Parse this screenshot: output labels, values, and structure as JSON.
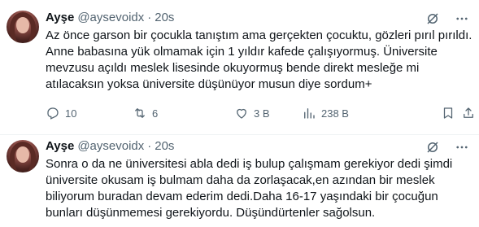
{
  "tweets": [
    {
      "author": {
        "name": "Ayşe",
        "handle": "@aysevoidx",
        "separator": "·",
        "time": "20s"
      },
      "text": "Az önce garson bir çocukla tanıştım ama gerçekten çocuktu, gözleri pırıl pırıldı. Anne babasına yük olmamak için 1 yıldır kafede çalışıyormuş. Üniversite mevzusu açıldı meslek lisesinde okuyormuş bende direkt mesleğe mi atılacaksın yoksa üniversite düşünüyor musun diye sordum+",
      "stats": {
        "replies": "10",
        "retweets": "6",
        "likes": "3 B",
        "views": "238 B"
      }
    },
    {
      "author": {
        "name": "Ayşe",
        "handle": "@aysevoidx",
        "separator": "·",
        "time": "20s"
      },
      "text": "Sonra o da ne üniversitesi abla dedi iş bulup çalışmam gerekiyor dedi şimdi üniversite okusam iş bulmam daha da zorlaşacak,en azından bir meslek biliyorum buradan devam ederim dedi.Daha 16-17 yaşındaki bir çocuğun bunları düşünmemesi gerekiyordu. Düşündürtenler sağolsun."
    }
  ],
  "icons": {
    "grok": "grok-icon",
    "more": "more-icon",
    "reply": "reply-icon",
    "retweet": "retweet-icon",
    "like": "heart-icon",
    "views": "views-icon",
    "bookmark": "bookmark-icon",
    "share": "share-icon"
  },
  "colors": {
    "text": "#0f1419",
    "secondary": "#536471",
    "divider": "#eff3f4"
  }
}
